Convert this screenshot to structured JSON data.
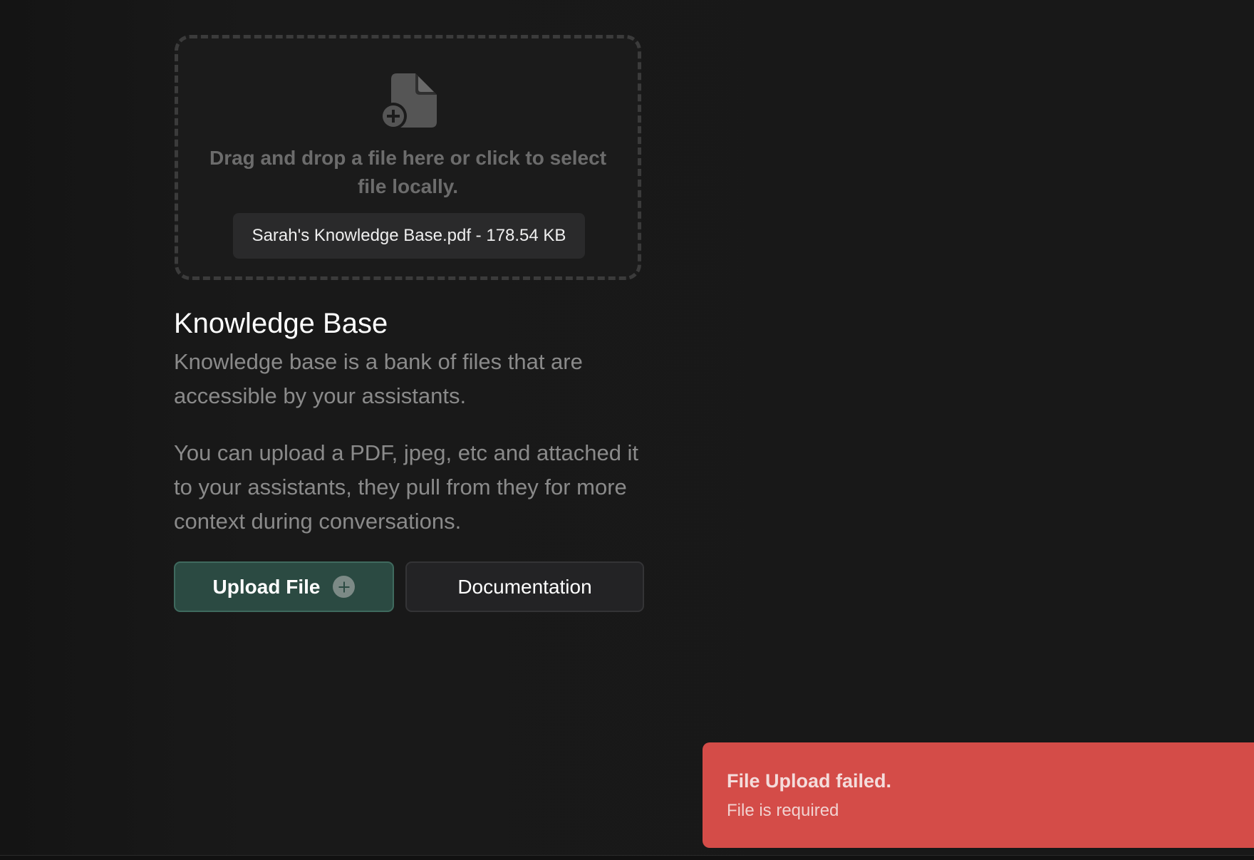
{
  "dropzone": {
    "hint": "Drag and drop a file here or click to select file locally.",
    "selected_file": "Sarah's Knowledge Base.pdf - 178.54 KB",
    "icon": "file-add-icon"
  },
  "knowledge_base": {
    "title": "Knowledge Base",
    "description": "Knowledge base is a bank of files that are accessible by your assistants.",
    "details": "You can upload a PDF, jpeg, etc and attached it to your assistants, they pull from they for more context during conversations."
  },
  "actions": {
    "upload_label": "Upload File",
    "upload_icon": "plus-circle-icon",
    "docs_label": "Documentation"
  },
  "toast": {
    "title": "File Upload failed.",
    "message": "File is required",
    "color": "#d44c48"
  },
  "colors": {
    "background": "#181818",
    "primary_button": "#2b4a42",
    "secondary_button": "#232325"
  }
}
